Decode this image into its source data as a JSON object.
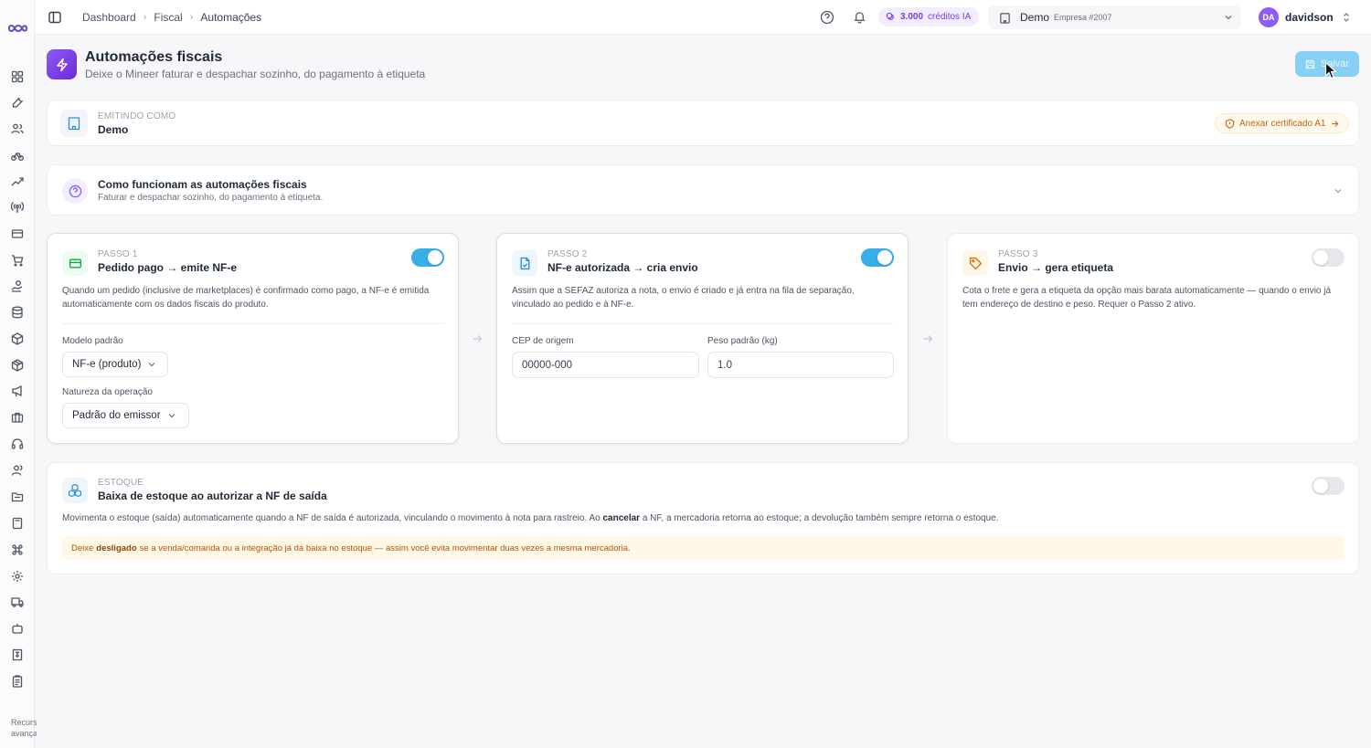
{
  "app": {
    "sidebar_footer": "Recursos avançados"
  },
  "topbar": {
    "breadcrumb": [
      "Dashboard",
      "Fiscal",
      "Automações"
    ],
    "credits_value": "3.000",
    "credits_label": "créditos IA",
    "company_name": "Demo",
    "company_sub": "Empresa #2007",
    "user_initials": "DA",
    "user_name": "davidson"
  },
  "header": {
    "title": "Automações fiscais",
    "subtitle": "Deixe o Mineer faturar e despachar sozinho, do pagamento à etiqueta",
    "save_label": "Salvar"
  },
  "emitter": {
    "eyebrow": "EMITINDO COMO",
    "name": "Demo",
    "cert_label": "Anexar certificado A1"
  },
  "how": {
    "title": "Como funcionam as automações fiscais",
    "description": "Faturar e despachar sozinho, do pagamento à etiqueta."
  },
  "steps": [
    {
      "eyebrow": "PASSO 1",
      "title": "Pedido pago → emite NF-e",
      "description": "Quando um pedido (inclusive de marketplaces) é confirmado como pago, a NF-e é emitida automaticamente com os dados fiscais do produto.",
      "enabled": true,
      "model_label": "Modelo padrão",
      "model_value": "NF-e (produto)",
      "nature_label": "Natureza da operação",
      "nature_value": "Padrão do emissor"
    },
    {
      "eyebrow": "PASSO 2",
      "title": "NF-e autorizada → cria envio",
      "description": "Assim que a SEFAZ autoriza a nota, o envio é criado e já entra na fila de separação, vinculado ao pedido e à NF-e.",
      "enabled": true,
      "cep_label": "CEP de origem",
      "cep_placeholder": "00000-000",
      "weight_label": "Peso padrão (kg)",
      "weight_value": "1.0"
    },
    {
      "eyebrow": "PASSO 3",
      "title": "Envio → gera etiqueta",
      "description": "Cota o frete e gera a etiqueta da opção mais barata automaticamente — quando o envio já tem endereço de destino e peso. Requer o Passo 2 ativo.",
      "enabled": false
    }
  ],
  "stock": {
    "eyebrow": "ESTOQUE",
    "title": "Baixa de estoque ao autorizar a NF de saída",
    "desc_before": "Movimenta o estoque (saída) automaticamente quando a NF de saída é autorizada, vinculando o movimento à nota para rastreio. Ao ",
    "desc_bold": "cancelar",
    "desc_after": " a NF, a mercadoria retorna ao estoque; a devolução também sempre retorna o estoque.",
    "enabled": false,
    "warn_before": "Deixe ",
    "warn_bold": "desligado",
    "warn_after": " se a venda/comanda ou a integração já dá baixa no estoque — assim você evita movimentar duas vezes a mesma mercadoria."
  },
  "colors": {
    "accent": "#38aee8",
    "brand_purple": "#7c3aed",
    "warning": "#c2660c"
  }
}
